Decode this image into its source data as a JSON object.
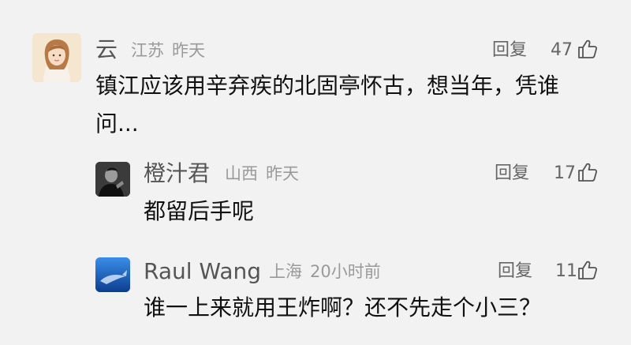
{
  "comments": [
    {
      "author": "云",
      "location": "江苏",
      "time": "昨天",
      "reply_label": "回复",
      "likes": "47",
      "text_line1": "镇江应该用辛弃疾的北固亭怀古，想当年，凭谁",
      "text_line2": "问..."
    },
    {
      "author": "橙汁君",
      "location": "山西",
      "time": "昨天",
      "reply_label": "回复",
      "likes": "17",
      "text_line1": "都留后手呢"
    },
    {
      "author": "Raul Wang",
      "location": "上海",
      "time": "20小时前",
      "reply_label": "回复",
      "likes": "11",
      "text_line1": "谁一上来就用王炸啊？还不先走个小三？"
    }
  ],
  "colors": {
    "background": "#f2f2f2",
    "name": "#555555",
    "meta": "#9a9a9a",
    "text": "#111111"
  }
}
